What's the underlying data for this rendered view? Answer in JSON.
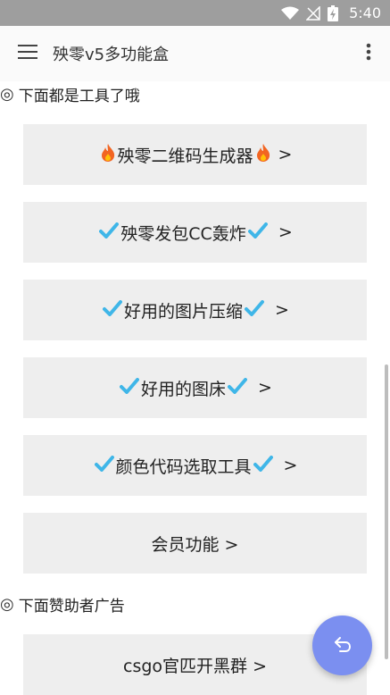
{
  "status": {
    "time": "5:40"
  },
  "appbar": {
    "title": "殃零v5多功能盒"
  },
  "section1": {
    "ring": "◎",
    "label": "下面都是工具了哦"
  },
  "cards": [
    {
      "label": "殃零二维码生成器",
      "chev": ">"
    },
    {
      "label": "殃零发包CC轰炸",
      "chev": ">"
    },
    {
      "label": "好用的图片压缩",
      "chev": ">"
    },
    {
      "label": "好用的图床",
      "chev": ">"
    },
    {
      "label": "颜色代码选取工具",
      "chev": ">"
    },
    {
      "label": "会员功能 >"
    }
  ],
  "section2": {
    "ring": "◎",
    "label": "下面赞助者广告"
  },
  "ad_card": {
    "label": "csgo官匹开黑群 >"
  },
  "colors": {
    "check": "#3fb6e8",
    "fire": "#f26522",
    "fab": "#7b8ff0"
  }
}
